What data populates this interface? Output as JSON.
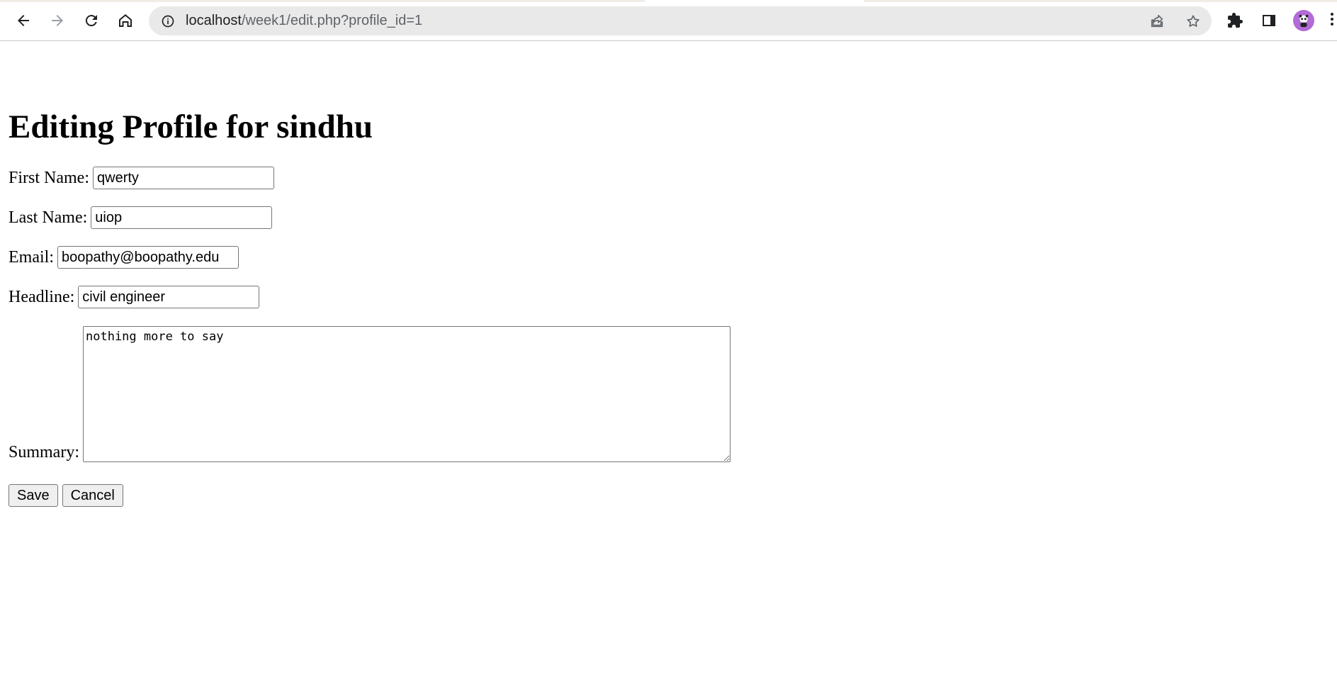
{
  "browser": {
    "url_host": "localhost",
    "url_path": "/week1/edit.php?profile_id=1",
    "icons": {
      "back": "back-arrow-icon",
      "forward": "forward-arrow-icon",
      "reload": "reload-icon",
      "home": "home-icon",
      "site_info": "info-icon",
      "share": "share-icon",
      "bookmark": "star-icon",
      "extensions": "puzzle-icon",
      "side_panel": "side-panel-icon",
      "profile": "avatar-icon",
      "menu": "kebab-menu-icon"
    }
  },
  "page": {
    "title": "Editing Profile for sindhu",
    "fields": {
      "first_name": {
        "label": "First Name:",
        "value": "qwerty"
      },
      "last_name": {
        "label": "Last Name:",
        "value": "uiop"
      },
      "email": {
        "label": "Email:",
        "value": "boopathy@boopathy.edu"
      },
      "headline": {
        "label": "Headline:",
        "value": "civil engineer"
      },
      "summary": {
        "label": "Summary:",
        "value": "nothing more to say"
      }
    },
    "buttons": {
      "save": "Save",
      "cancel": "Cancel"
    }
  }
}
